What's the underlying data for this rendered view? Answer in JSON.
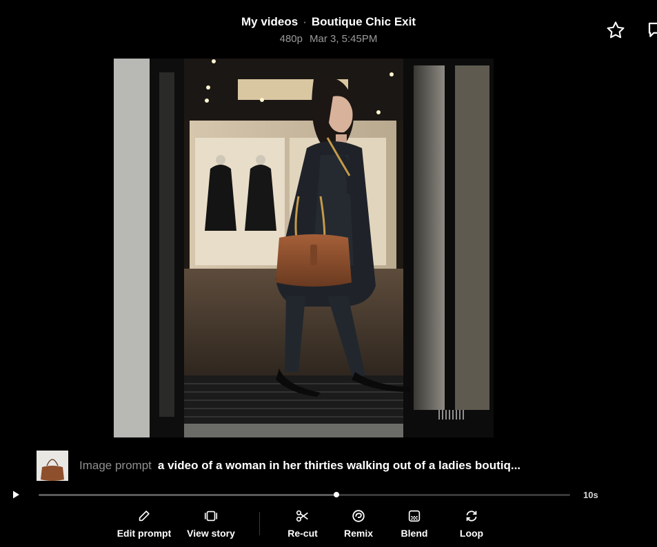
{
  "header": {
    "folder": "My videos",
    "separator": "·",
    "title": "Boutique Chic Exit",
    "resolution": "480p",
    "date": "Mar 3, 5:45PM"
  },
  "icons": {
    "favorite": "star-outline-icon",
    "more": "comment-icon"
  },
  "prompt": {
    "label": "Image prompt",
    "text": "a video of a woman in her thirties walking out of a ladies boutiq..."
  },
  "player": {
    "duration": "10s",
    "progress": 0.56
  },
  "toolbar": {
    "edit_prompt": "Edit prompt",
    "view_story": "View story",
    "recut": "Re-cut",
    "remix": "Remix",
    "blend": "Blend",
    "loop": "Loop"
  }
}
